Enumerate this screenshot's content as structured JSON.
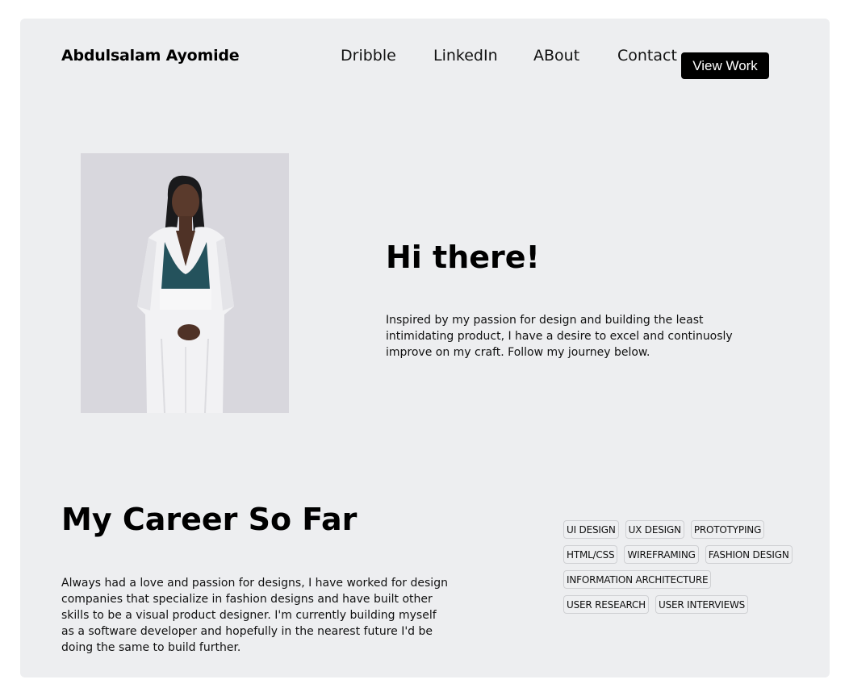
{
  "header": {
    "brand": "Abdulsalam Ayomide",
    "nav": [
      "Dribble",
      "LinkedIn",
      "ABout",
      "Contact"
    ],
    "cta": "View Work"
  },
  "hero": {
    "title": "Hi there!",
    "text": "Inspired by my passion for design and building the least intimidating product, I have a desire to excel and continuosly improve on my craft. Follow my journey below."
  },
  "career": {
    "title": "My Career So Far",
    "text": "Always had a love and passion for designs, I have worked for design companies that specialize in fashion designs and have built other skills to be a visual product designer. I'm currently building myself as a software developer and hopefully in the nearest future I'd be doing the same to build further."
  },
  "skills": [
    [
      "UI DESIGN",
      "UX DESIGN",
      "PROTOTYPING"
    ],
    [
      "HTML/CSS",
      "WIREFRAMING",
      "FASHION DESIGN"
    ],
    [
      "INFORMATION ARCHITECTURE"
    ],
    [
      "USER RESEARCH",
      "USER INTERVIEWS"
    ]
  ]
}
